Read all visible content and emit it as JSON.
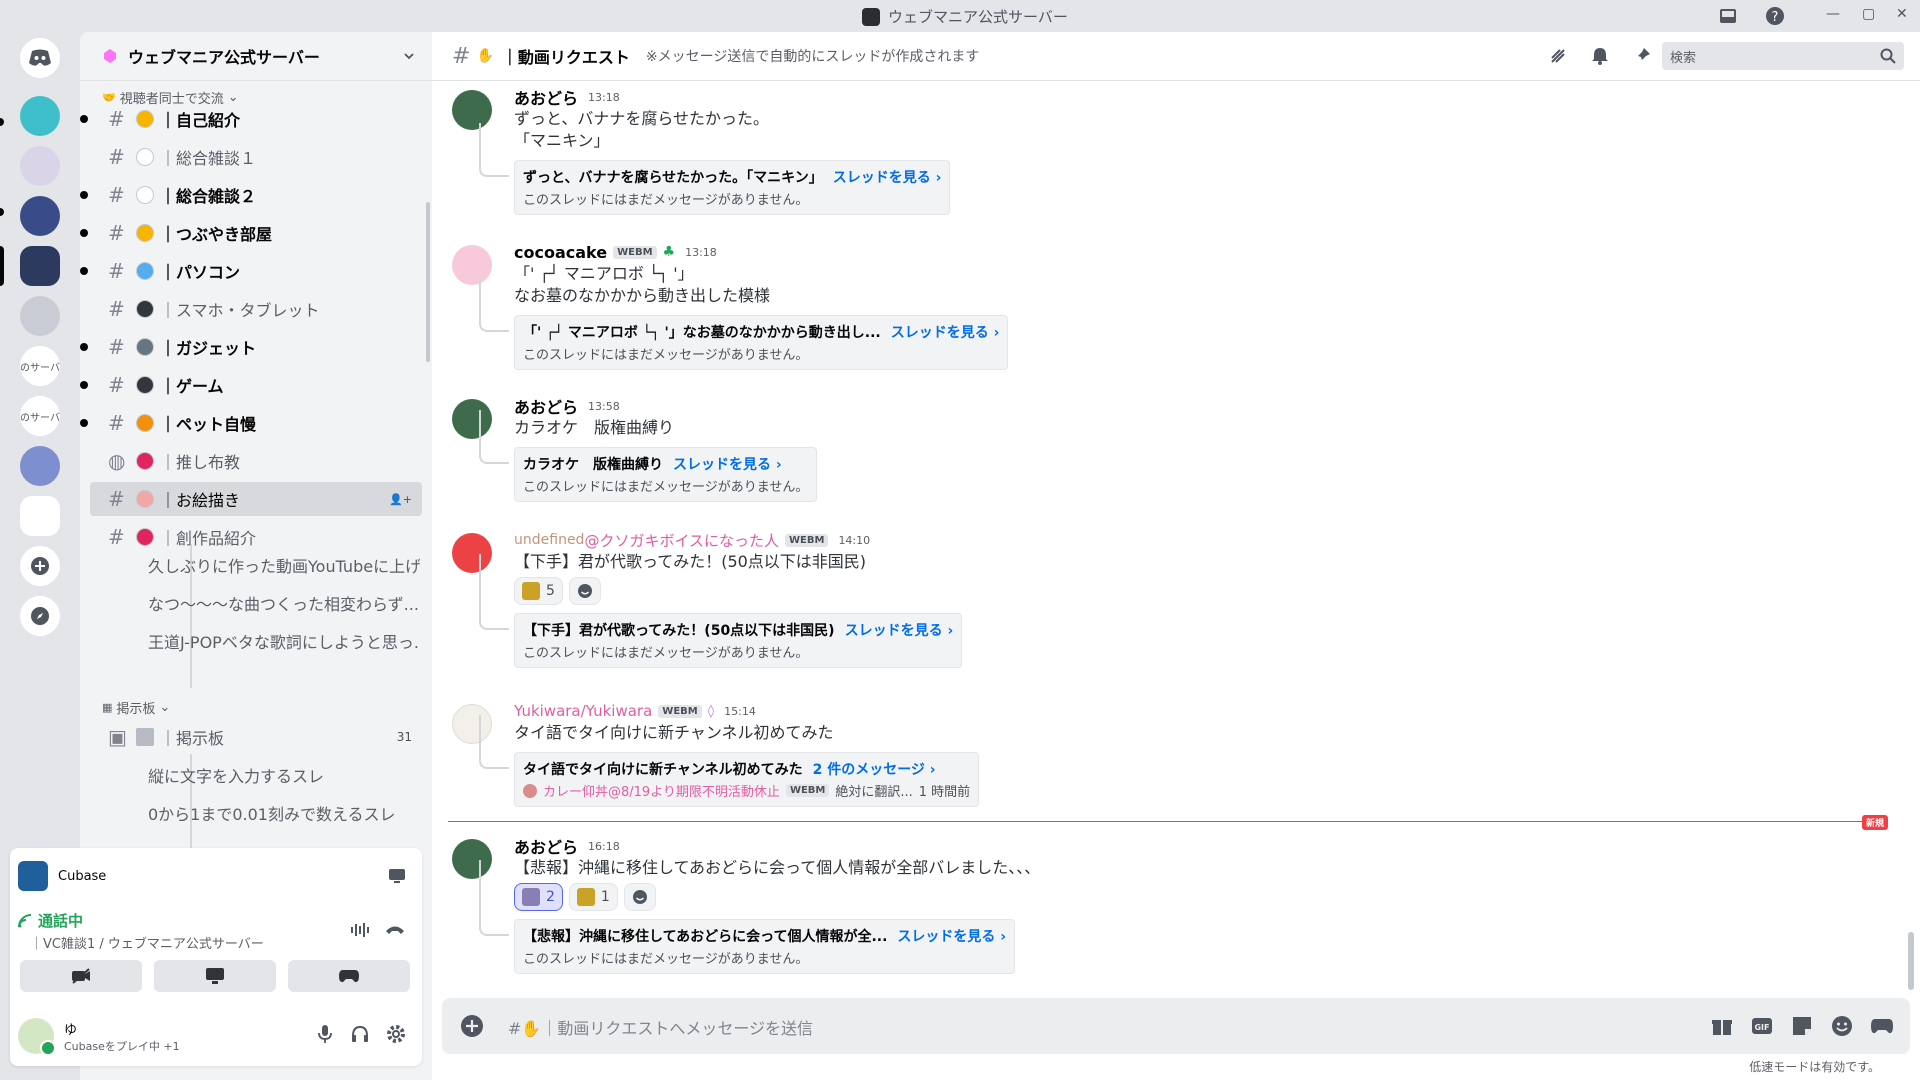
{
  "window": {
    "title": "ウェブマニア公式サーバー"
  },
  "server": {
    "name": "ウェブマニア公式サーバー"
  },
  "guild_labels": [
    "のサーバ",
    "のサーバ"
  ],
  "sidebar": {
    "category1": "視聴者同士で交流",
    "channels": [
      {
        "label": "｜自己紹介",
        "emoji_color": "#f7b500",
        "unread": true
      },
      {
        "label": "｜総合雑談１",
        "emoji_color": "#ffffff",
        "unread": false
      },
      {
        "label": "｜総合雑談２",
        "emoji_color": "#ffffff",
        "unread": true
      },
      {
        "label": "｜つぶやき部屋",
        "emoji_color": "#f7b500",
        "unread": true
      },
      {
        "label": "｜パソコン",
        "emoji_color": "#55acee",
        "unread": true
      },
      {
        "label": "｜スマホ・タブレット",
        "emoji_color": "#31373d",
        "unread": false
      },
      {
        "label": "｜ガジェット",
        "emoji_color": "#66757f",
        "unread": true
      },
      {
        "label": "｜ゲーム",
        "emoji_color": "#31373d",
        "unread": true
      },
      {
        "label": "｜ペット自慢",
        "emoji_color": "#f4900c",
        "unread": true
      },
      {
        "label": "｜推し布教",
        "emoji_color": "#e0245e",
        "unread": false
      },
      {
        "label": "｜お絵描き",
        "emoji_color": "#f2a6a6",
        "unread": false
      },
      {
        "label": "｜創作品紹介",
        "emoji_color": "#e0245e",
        "unread": false
      }
    ],
    "threads": [
      "久しぶりに作った動画YouTubeに上げ...",
      "なつ〜〜〜な曲つくった相変わらず...",
      "王道J-POPベタな歌詞にしようと思っ..."
    ],
    "category2": "掲示板",
    "forum": {
      "label": "｜掲示板",
      "count": "31"
    },
    "forum_threads": [
      "縦に文字を入力するスレ",
      "0から1まで0.01刻みで数えるスレ"
    ]
  },
  "panel": {
    "activity_app": "Cubase",
    "voice_status": "通話中",
    "voice_channel": "｜VC雑談1 / ウェブマニア公式サーバー",
    "username": "ゆ",
    "user_status": "Cubaseをプレイ中 +1"
  },
  "channel": {
    "name": "｜動画リクエスト",
    "topic": "※メッセージ送信で自動的にスレッドが作成されます",
    "search_placeholder": "検索",
    "composer_placeholder": "｜動画リクエストへメッセージを送信",
    "slowmode": "低速モードは有効です。"
  },
  "messages": [
    {
      "author": "あおどら",
      "time": "13:18",
      "lines": [
        "ずっと、バナナを腐らせたかった。",
        "「マニキン」"
      ],
      "thread_title": "ずっと、バナナを腐らせたかった。「マニキン」",
      "thread_link": "スレッドを見る ›",
      "thread_sub": "このスレッドにはまだメッセージがありません。"
    },
    {
      "author": "cocoacake",
      "tag": "WEBM",
      "time": "13:18",
      "lines": [
        "「' ┌┘ マニアロボ └┐ '」",
        "なお墓のなかかから動き出した模様"
      ],
      "thread_title": "「' ┌┘ マニアロボ └┐ '」なお墓のなかかから動き出し...",
      "thread_link": "スレッドを見る ›",
      "thread_sub": "このスレッドにはまだメッセージがありません。"
    },
    {
      "author": "あおどら",
      "time": "13:58",
      "lines": [
        "カラオケ　版権曲縛り"
      ],
      "thread_title": "カラオケ　版権曲縛り",
      "thread_link": "スレッドを見る ›",
      "thread_sub": "このスレッドにはまだメッセージがありません。"
    },
    {
      "author_a": "undefined",
      "author_b": "@クソガキボイスになった人",
      "tag": "WEBM",
      "time": "14:10",
      "lines": [
        "【下手】君が代歌ってみた！(50点以下は非国民)"
      ],
      "reaction_count": "5",
      "thread_title": "【下手】君が代歌ってみた！(50点以下は非国民)",
      "thread_link": "スレッドを見る ›",
      "thread_sub": "このスレッドにはまだメッセージがありません。"
    },
    {
      "author": "Yukiwara/Yukiwara",
      "tag": "WEBM",
      "time": "15:14",
      "lines": [
        "タイ語でタイ向けに新チャンネル初めてみた"
      ],
      "thread_title": "タイ語でタイ向けに新チャンネル初めてみた",
      "thread_link": "2 件のメッセージ ›",
      "last_author": "カレー仰丼@8/19より期限不明活動休止",
      "last_tag": "WEBM",
      "last_text": "絶対に翻訳...",
      "last_time": "1 時間前"
    },
    {
      "author": "あおどら",
      "time": "16:18",
      "lines": [
        "【悲報】沖縄に移住してあおどらに会って個人情報が全部バレました、、、"
      ],
      "reactions": [
        "2",
        "1"
      ],
      "thread_title": "【悲報】沖縄に移住してあおどらに会って個人情報が全...",
      "thread_link": "スレッドを見る ›",
      "thread_sub": "このスレッドにはまだメッセージがありません。"
    }
  ],
  "new_label": "新規",
  "colors": {
    "link": "#006ce7",
    "new_divider": "#f23f43",
    "voice_connected": "#23a559",
    "undefined_name": "#c5937b",
    "name_pink": "#e25da2"
  }
}
